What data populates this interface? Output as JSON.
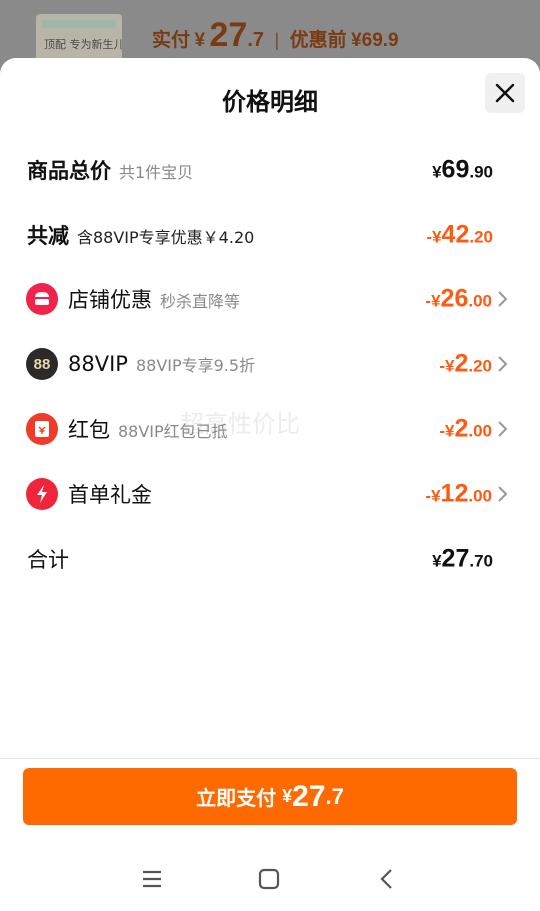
{
  "background": {
    "product_thumb_text": "顶配 专为新生儿",
    "paid_label": "实付",
    "paid_currency": "¥",
    "paid_int": "27",
    "paid_dec": ".7",
    "before_label": "优惠前",
    "before_price": "¥69.9"
  },
  "sheet": {
    "title": "价格明细",
    "watermark": "超高性价比",
    "rows": [
      {
        "label": "商品总价",
        "sub": "共1件宝贝",
        "cur": "¥",
        "int": "69",
        "dec": ".90"
      },
      {
        "label": "共减",
        "sub": "含88VIP专享优惠￥4.20",
        "cur": "-¥",
        "int": "42",
        "dec": ".20"
      },
      {
        "label": "店铺优惠",
        "sub": "秒杀直降等",
        "cur": "-¥",
        "int": "26",
        "dec": ".00"
      },
      {
        "label": "88VIP",
        "sub": "88VIP专享9.5折",
        "cur": "-¥",
        "int": "2",
        "dec": ".20",
        "icon_text": "88"
      },
      {
        "label": "红包",
        "sub": "88VIP红包已抵",
        "cur": "-¥",
        "int": "2",
        "dec": ".00"
      },
      {
        "label": "首单礼金",
        "sub": "",
        "cur": "-¥",
        "int": "12",
        "dec": ".00"
      },
      {
        "label": "合计",
        "sub": "",
        "cur": "¥",
        "int": "27",
        "dec": ".70"
      }
    ],
    "pay_button": {
      "label": "立即支付",
      "cur": "¥",
      "int": "27",
      "dec": ".7"
    }
  },
  "icons": {
    "close": "close-icon",
    "shop": "shop-icon",
    "vip": "vip88-icon",
    "redpacket": "red-packet-icon",
    "bolt": "lightning-icon",
    "chevron": "chevron-right-icon"
  },
  "colors": {
    "accent": "#ff6a00",
    "discount": "#ff5a12",
    "shop_icon": "#f0234a",
    "vip_icon": "#2b2a29",
    "redpacket_icon": "#f03a2a",
    "bolt_icon": "#f0243a"
  }
}
